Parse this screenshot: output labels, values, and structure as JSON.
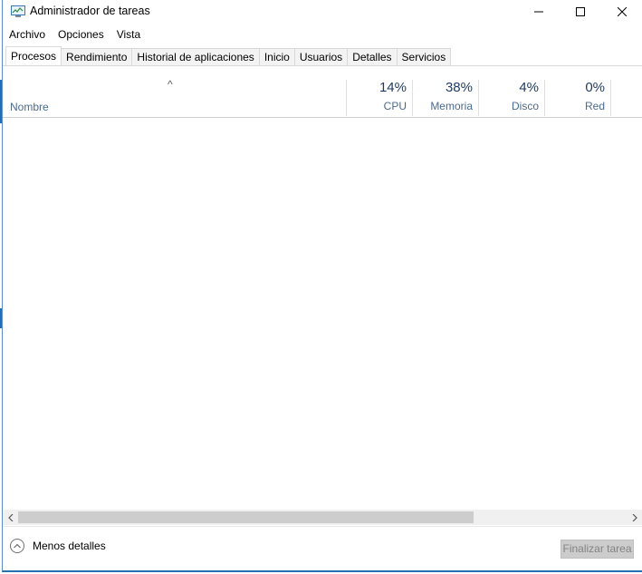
{
  "window": {
    "title": "Administrador de tareas"
  },
  "window_controls": {
    "minimize_icon": "minimize-icon",
    "maximize_icon": "maximize-icon",
    "close_icon": "close-icon"
  },
  "menu": {
    "items": [
      "Archivo",
      "Opciones",
      "Vista"
    ]
  },
  "tabs": [
    {
      "label": "Procesos",
      "active": true
    },
    {
      "label": "Rendimiento",
      "active": false
    },
    {
      "label": "Historial de aplicaciones",
      "active": false
    },
    {
      "label": "Inicio",
      "active": false
    },
    {
      "label": "Usuarios",
      "active": false
    },
    {
      "label": "Detalles",
      "active": false
    },
    {
      "label": "Servicios",
      "active": false
    }
  ],
  "table": {
    "sort_indicator": "^",
    "name_column": "Nombre",
    "columns": [
      {
        "percent": "14%",
        "label": "CPU"
      },
      {
        "percent": "38%",
        "label": "Memoria"
      },
      {
        "percent": "4%",
        "label": "Disco"
      },
      {
        "percent": "0%",
        "label": "Red"
      }
    ],
    "rows": []
  },
  "footer": {
    "fewer_details": "Menos detalles",
    "end_task": "Finalizar tarea",
    "end_task_enabled": false
  },
  "colors": {
    "accent": "#2b6fb3",
    "header_text": "#4b6a8f",
    "disabled_button": "#cccccc"
  }
}
